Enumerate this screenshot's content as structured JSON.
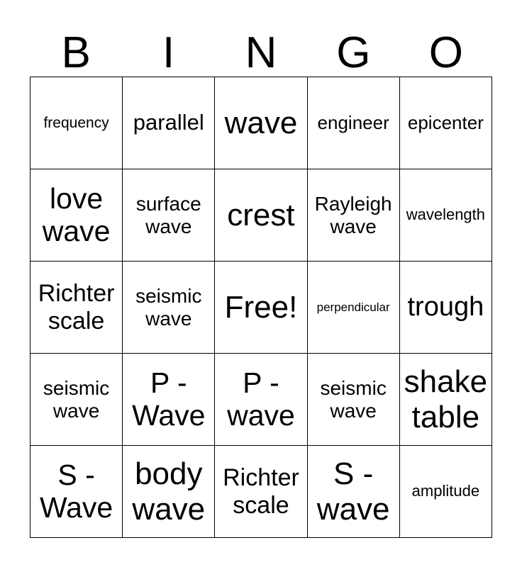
{
  "card": {
    "title_letters": [
      "B",
      "I",
      "N",
      "G",
      "O"
    ],
    "free_space_label": "Free!",
    "rows": [
      [
        {
          "text": "frequency",
          "size": "fs-sm"
        },
        {
          "text": "parallel",
          "size": "fs-lg"
        },
        {
          "text": "wave",
          "size": "fs-huge"
        },
        {
          "text": "engineer",
          "size": "fs-md"
        },
        {
          "text": "epicenter",
          "size": "fs-md"
        }
      ],
      [
        {
          "text": "love wave",
          "size": "fs-xxl"
        },
        {
          "text": "surface wave",
          "size": "fs-md2"
        },
        {
          "text": "crest",
          "size": "fs-huge"
        },
        {
          "text": "Rayleigh wave",
          "size": "fs-md2"
        },
        {
          "text": "wavelength",
          "size": "fs-sm2"
        }
      ],
      [
        {
          "text": "Richter scale",
          "size": "fs-lg2"
        },
        {
          "text": "seismic wave",
          "size": "fs-md2"
        },
        {
          "text": "Free!",
          "size": "fs-huge"
        },
        {
          "text": "perpendicular",
          "size": "fs-xs"
        },
        {
          "text": "trough",
          "size": "fs-xl"
        }
      ],
      [
        {
          "text": "seismic wave",
          "size": "fs-md2"
        },
        {
          "text": "P - Wave",
          "size": "fs-xxl"
        },
        {
          "text": "P - wave",
          "size": "fs-xxl"
        },
        {
          "text": "seismic wave",
          "size": "fs-md2"
        },
        {
          "text": "shake table",
          "size": "fs-huge"
        }
      ],
      [
        {
          "text": "S - Wave",
          "size": "fs-xxl"
        },
        {
          "text": "body wave",
          "size": "fs-huge"
        },
        {
          "text": "Richter scale",
          "size": "fs-lg2"
        },
        {
          "text": "S - wave",
          "size": "fs-huge"
        },
        {
          "text": "amplitude",
          "size": "fs-sm2"
        }
      ]
    ]
  }
}
